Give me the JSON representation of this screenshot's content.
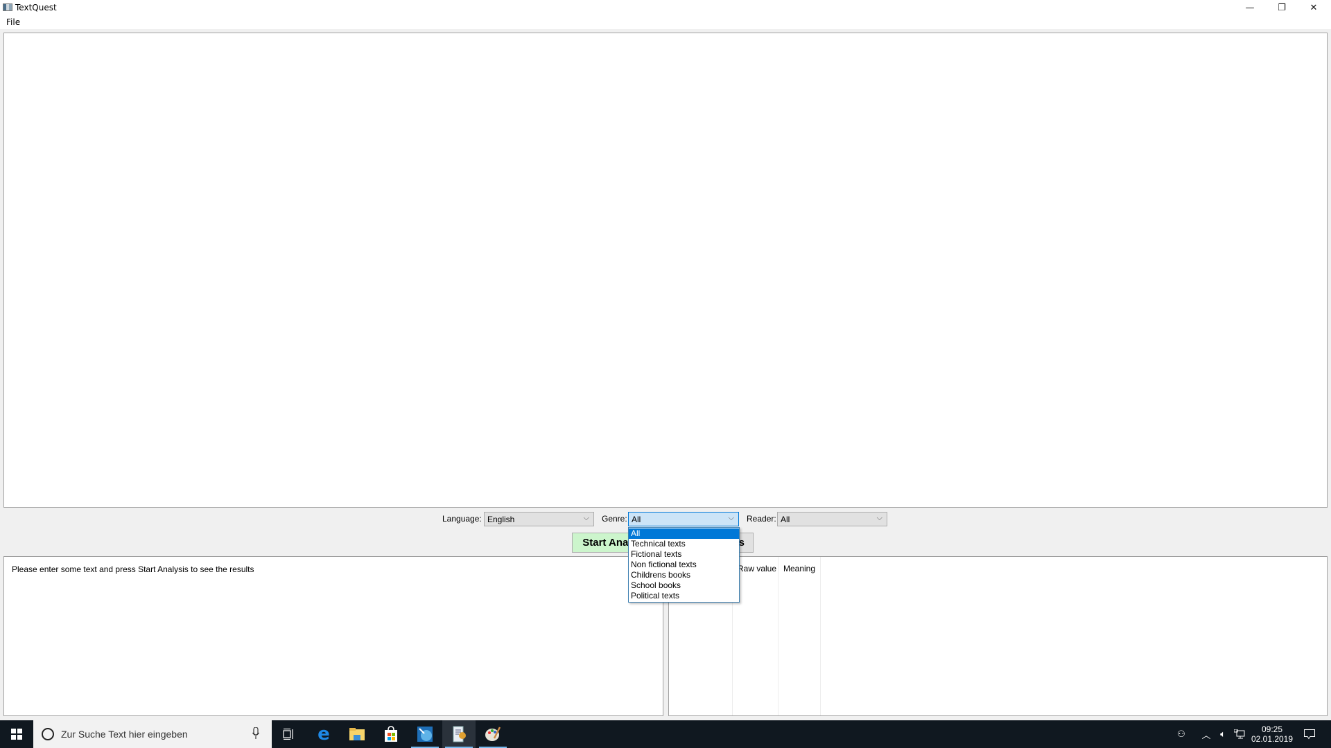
{
  "window": {
    "title": "TextQuest",
    "controls": {
      "minimize": "—",
      "restore": "❐",
      "close": "✕"
    }
  },
  "menu": {
    "items": [
      "File"
    ]
  },
  "editor": {
    "value": "",
    "placeholder": ""
  },
  "controls": {
    "language": {
      "label": "Language:",
      "value": "English"
    },
    "genre": {
      "label": "Genre:",
      "value": "All",
      "options": [
        "All",
        "Technical texts",
        "Fictional texts",
        "Non fictional texts",
        "Childrens books",
        "School books",
        "Political texts"
      ],
      "selected_index": 0,
      "expanded": true
    },
    "reader": {
      "label": "Reader:",
      "value": "All"
    },
    "chevron": "⌵"
  },
  "buttons": {
    "start_analysis": "Start Analysis",
    "second_visible_fragment": "s"
  },
  "results": {
    "message": "Please enter some text and press Start Analysis to see the results",
    "table_headers": [
      "",
      "Raw value",
      "Meaning"
    ]
  },
  "taskbar": {
    "search_placeholder": "Zur Suche Text hier eingeben",
    "pinned": [
      "task-view",
      "edge",
      "file-explorer",
      "store",
      "remote-desktop",
      "textquest",
      "paint"
    ],
    "active": "textquest",
    "clock_time": "09:25",
    "clock_date": "02.01.2019"
  },
  "colors": {
    "accent": "#0078d7",
    "start_button_bg": "#ccf5cc",
    "taskbar_bg": "#101820"
  }
}
